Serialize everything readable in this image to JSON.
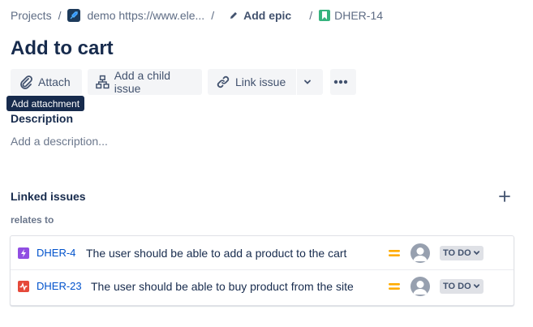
{
  "breadcrumb": {
    "projects": "Projects",
    "project": "demo https://www.ele...",
    "add_epic": "Add epic",
    "issue_key": "DHER-14",
    "separator": "/"
  },
  "issue": {
    "title": "Add to cart"
  },
  "toolbar": {
    "attach": "Attach",
    "add_child": "Add a child issue",
    "link_issue": "Link issue"
  },
  "tooltip": {
    "text": "Add attachment"
  },
  "description": {
    "title": "Description",
    "placeholder": "Add a description..."
  },
  "linked_issues": {
    "title": "Linked issues",
    "relation": "relates to",
    "items": [
      {
        "key": "DHER-4",
        "summary": "The user should be able to add a product to the cart",
        "type_icon": "lightning-icon",
        "type_color": "#904ee2",
        "status": "TO DO"
      },
      {
        "key": "DHER-23",
        "summary": "The user should be able to buy product from the site",
        "type_icon": "pulse-icon",
        "type_color": "#e5493a",
        "status": "TO DO"
      }
    ]
  },
  "colors": {
    "priority": "#ffab00",
    "link": "#0052cc",
    "story": "#36b37e"
  }
}
